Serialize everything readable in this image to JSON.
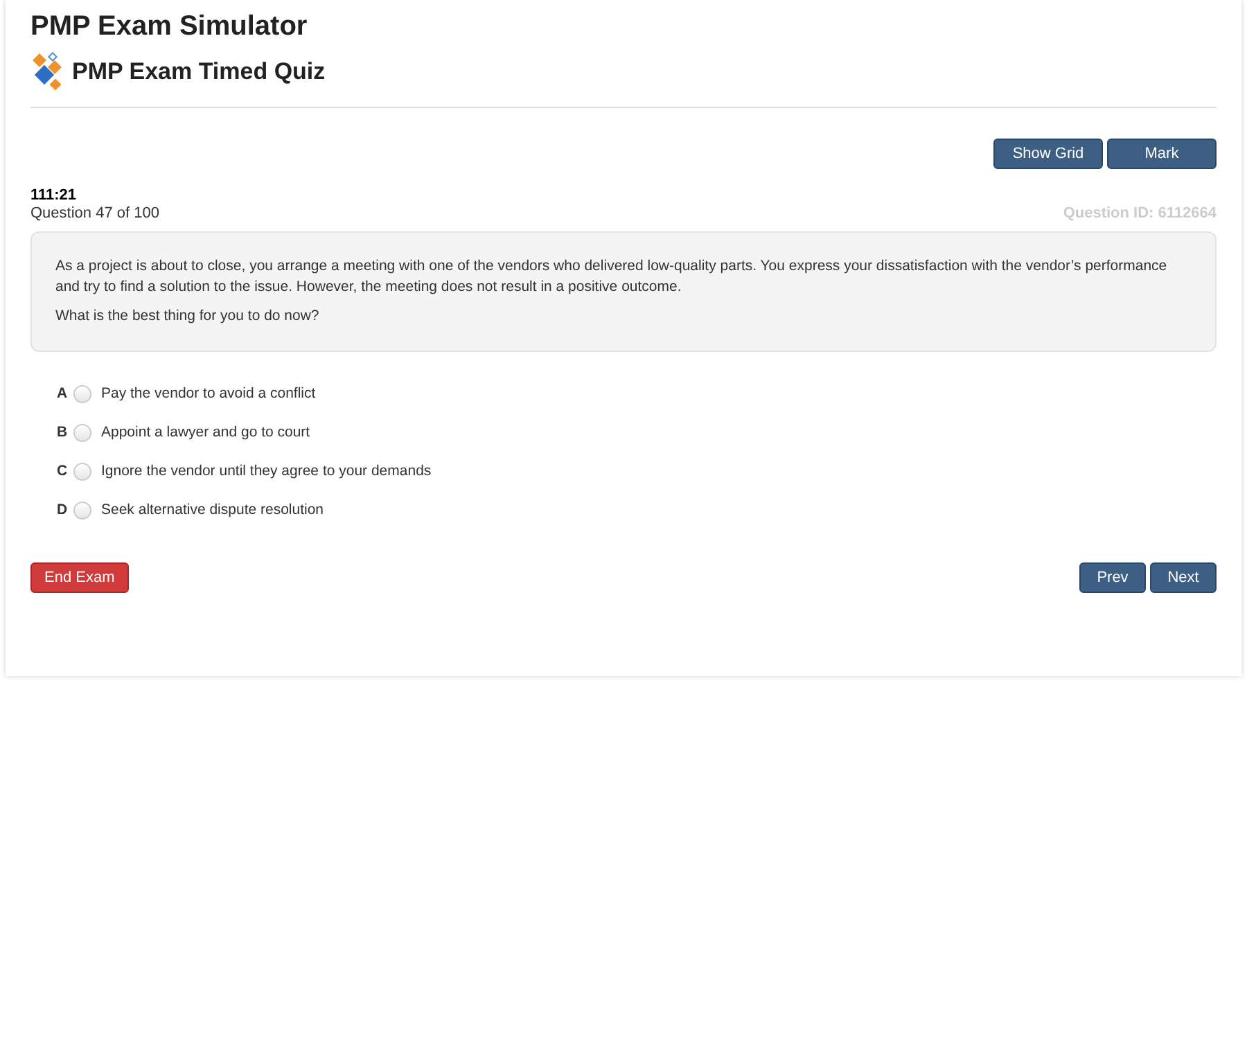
{
  "app_title": "PMP Exam Simulator",
  "quiz_title": "PMP Exam Timed Quiz",
  "top_buttons": [
    "Show Grid",
    "Mark"
  ],
  "timer": "111:21",
  "progress": "Question 47 of 100",
  "question_id": "Question ID: 6112664",
  "question": {
    "paragraphs": [
      "As a project is about to close, you arrange a meeting with one of the vendors who delivered low-quality parts. You express your dissatisfaction with the vendor’s performance and try to find a solution to the issue. However, the meeting does not result in a positive outcome.",
      "What is the best thing for you to do now?"
    ]
  },
  "options": [
    {
      "letter": "A",
      "text": "Pay the vendor to avoid a conflict",
      "selected": false
    },
    {
      "letter": "B",
      "text": "Appoint a lawyer and go to court",
      "selected": false
    },
    {
      "letter": "C",
      "text": "Ignore the vendor until they agree to your demands",
      "selected": false
    },
    {
      "letter": "D",
      "text": "Seek alternative dispute resolution",
      "selected": false
    }
  ],
  "end_button": "End Exam",
  "nav_buttons": [
    "Prev",
    "Next"
  ]
}
